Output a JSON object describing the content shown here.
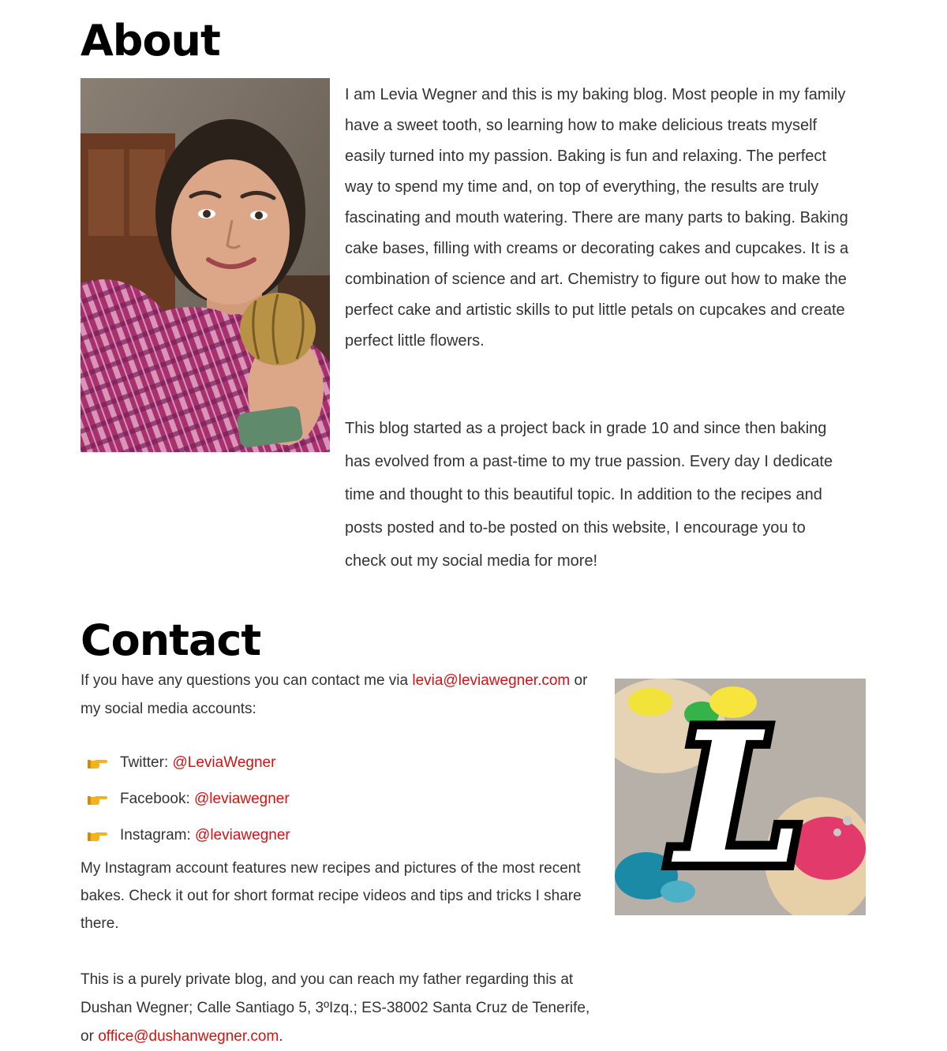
{
  "about": {
    "heading": "About",
    "p1": "I am Levia Wegner and this is my baking blog. Most people in my family have a sweet tooth, so learning how to make delicious treats myself easily turned into my passion. Baking is fun and relaxing. The perfect way to spend my time and, on top of everything, the results are truly fascinating and mouth watering. There are many parts to baking. Baking cake bases, filling with creams or decorating cakes and cupcakes. It is a combination of science and art. Chemistry to figure out how to make the perfect cake and artistic skills to put little petals on cupcakes and create perfect little flowers.",
    "p2": "This blog started as a project back in grade 10 and since then baking has evolved from a past-time to my true passion. Every day I dedicate time and thought to this beautiful topic. In addition to the recipes and posts posted and to-be posted on this website, I encourage you to check out my social media for more!"
  },
  "contact": {
    "heading": "Contact",
    "intro_before": "If you have any questions you can contact me via ",
    "email": "levia@leviawegner.com",
    "intro_after": " or my social media accounts:",
    "social": [
      {
        "label": "Twitter: ",
        "handle": "@LeviaWegner"
      },
      {
        "label": "Facebook: ",
        "handle": "@leviawegner"
      },
      {
        "label": "Instagram: ",
        "handle": "@leviawegner"
      }
    ],
    "instagram_note": "My Instagram account features new recipes and pictures of the most recent bakes. Check it out for short format recipe videos and tips and tricks I share there.",
    "private_before": "This is a purely private blog, and you can reach my father regarding this at Dushan Wegner; Calle Santiago 5, 3ºIzq.; ES-38002 Santa Cruz de Tenerife, or ",
    "private_email": "office@dushanwegner.com",
    "private_after": "."
  },
  "icons": {
    "list_bullet": "pointing-hand-icon",
    "logo": "L"
  },
  "colors": {
    "link": "#d31313",
    "heading": "#000000",
    "text": "#333333"
  }
}
